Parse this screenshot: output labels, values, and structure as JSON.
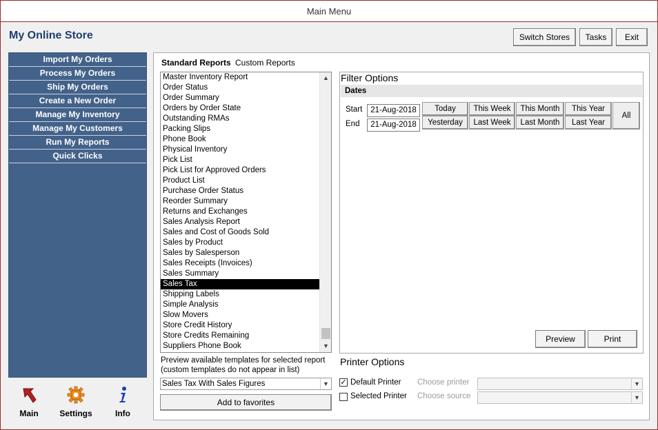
{
  "window": {
    "title": "Main Menu"
  },
  "app": {
    "title": "My Online Store"
  },
  "toolbar": {
    "switch_stores": "Switch Stores",
    "tasks": "Tasks",
    "exit": "Exit"
  },
  "sidebar": {
    "items": [
      {
        "label": "Import My Orders"
      },
      {
        "label": "Process My Orders"
      },
      {
        "label": "Ship My Orders"
      },
      {
        "label": "Create a New Order"
      },
      {
        "label": "Manage My Inventory"
      },
      {
        "label": "Manage My Customers"
      },
      {
        "label": "Run My Reports"
      },
      {
        "label": "Quick Clicks"
      }
    ]
  },
  "bottom_nav": {
    "main": {
      "label": "Main",
      "icon": "arrow-icon"
    },
    "settings": {
      "label": "Settings",
      "icon": "gear-icon"
    },
    "info": {
      "label": "Info",
      "icon": "info-icon"
    }
  },
  "tabs": {
    "standard": "Standard Reports",
    "custom": "Custom Reports"
  },
  "reports": [
    "Master Inventory Report",
    "Order Status",
    "Order Summary",
    "Orders by Order State",
    "Outstanding RMAs",
    "Packing Slips",
    "Phone Book",
    "Physical Inventory",
    "Pick List",
    "Pick List for Approved Orders",
    "Product List",
    "Purchase Order Status",
    "Reorder Summary",
    "Returns and Exchanges",
    "Sales Analysis Report",
    "Sales and Cost of Goods Sold",
    "Sales by Product",
    "Sales by Salesperson",
    "Sales Receipts (Invoices)",
    "Sales Summary",
    "Sales Tax",
    "Shipping Labels",
    "Simple Analysis",
    "Slow Movers",
    "Store Credit History",
    "Store Credits Remaining",
    "Suppliers Phone Book"
  ],
  "selected_report": "Sales Tax",
  "filter": {
    "title": "Filter Options",
    "dates_label": "Dates",
    "start_label": "Start",
    "end_label": "End",
    "start_value": "21-Aug-2018",
    "end_value": "21-Aug-2018",
    "buttons": {
      "today": "Today",
      "this_week": "This Week",
      "this_month": "This Month",
      "this_year": "This Year",
      "yesterday": "Yesterday",
      "last_week": "Last Week",
      "last_month": "Last Month",
      "last_year": "Last Year",
      "all": "All"
    },
    "preview": "Preview",
    "print": "Print"
  },
  "templates": {
    "note_line1": "Preview available templates for selected report",
    "note_line2": "(custom templates do not appear in list)",
    "selected": "Sales Tax With Sales Figures",
    "add_favorites": "Add to favorites"
  },
  "printer": {
    "title": "Printer Options",
    "default_printer": "Default Printer",
    "selected_printer": "Selected Printer",
    "choose_printer": "Choose printer",
    "choose_source": "Choose source",
    "default_checked": true,
    "selected_checked": false
  }
}
